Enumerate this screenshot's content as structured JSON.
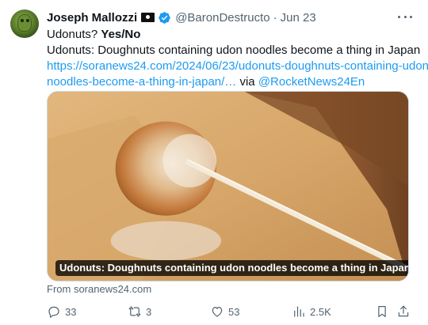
{
  "tweet": {
    "author": {
      "name": "Joseph Mallozzi",
      "handle": "@BaronDestructo",
      "separator": "·",
      "time": "Jun 23"
    },
    "body": {
      "line1_start": "Udonuts? ",
      "line1_bold": "Yes/No",
      "line2": "Udonuts: Doughnuts containing udon noodles become a thing in Japan",
      "link_line1": "https://soranews24.com/2024/06/23/udonuts-doughnuts-containing-udon-",
      "link_line2": "noodles-become-a-thing-in-japan/…",
      "via_text": " via ",
      "via_handle": "@RocketNews24En"
    },
    "card": {
      "caption": "Udonuts: Doughnuts containing udon noodles become a thing in Japan",
      "source": "From soranews24.com"
    },
    "actions": {
      "replies": "33",
      "retweets": "3",
      "likes": "53",
      "views": "2.5K"
    },
    "colors": {
      "link": "#1d9bf0",
      "muted": "#536471",
      "verified": "#1d9bf0"
    },
    "icons": [
      "flag-icon",
      "verified-icon",
      "more-icon",
      "reply-icon",
      "retweet-icon",
      "like-icon",
      "views-icon",
      "bookmark-icon",
      "share-icon"
    ]
  }
}
